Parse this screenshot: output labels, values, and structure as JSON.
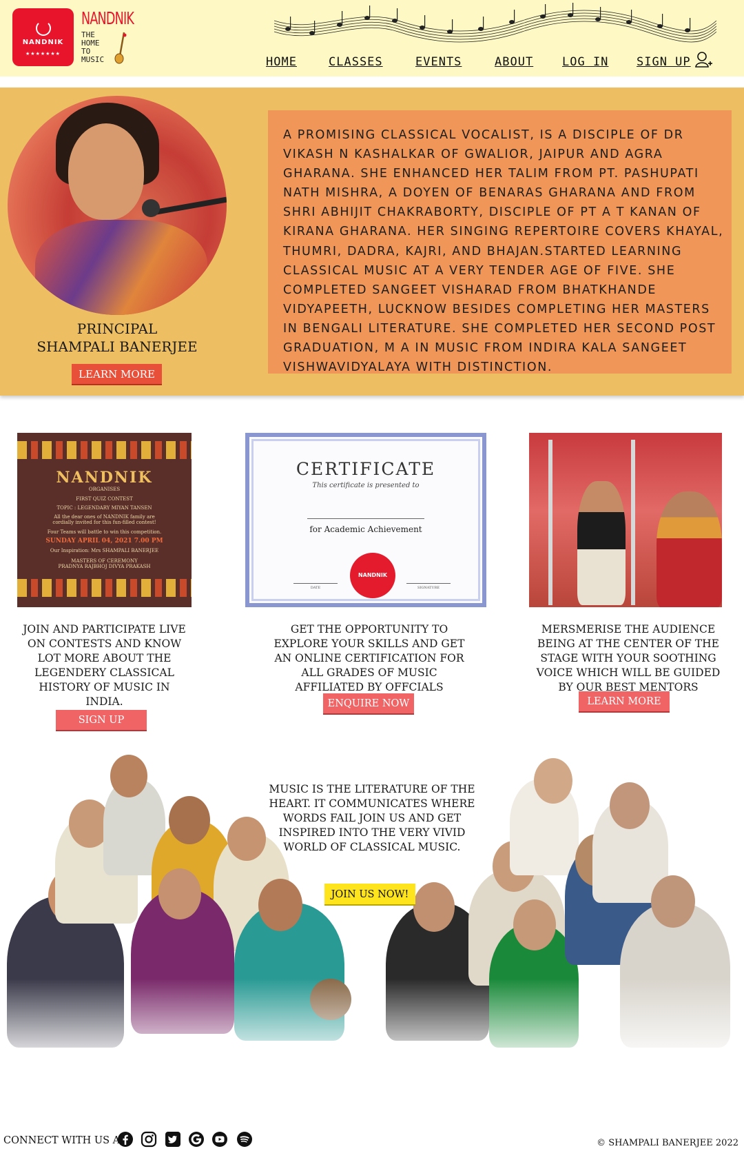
{
  "brand": {
    "logo_text": "NANDNIK",
    "name": "NANDNIK",
    "tagline": [
      "THE",
      "HOME",
      "TO",
      "MUSIC"
    ]
  },
  "nav": {
    "items": [
      "HOME",
      "CLASSES",
      "EVENTS",
      "ABOUT",
      "LOG IN",
      "SIGN UP"
    ]
  },
  "principal": {
    "role": "PRINCIPAL",
    "name": "SHAMPALI BANERJEE",
    "button": "LEARN MORE",
    "bio": "A PROMISING CLASSICAL VOCALIST, IS A DISCIPLE OF DR VIKASH N KASHALKAR OF GWALIOR,  JAIPUR AND AGRA GHARANA. SHE ENHANCED HER TALIM FROM PT. PASHUPATI NATH MISHRA, A DOYEN OF  BENARAS GHARANA AND FROM SHRI ABHIJIT CHAKRABORTY, DISCIPLE OF PT A T KANAN OF KIRANA GHARANA. HER  SINGING REPERTOIRE COVERS KHAYAL, THUMRI, DADRA, KAJRI, AND BHAJAN.STARTED LEARNING CLASSICAL MUSIC AT A VERY TENDER AGE OF FIVE. SHE COMPLETED  SANGEET VISHARAD FROM BHATKHANDE VIDYAPEETH, LUCKNOW BESIDES COMPLETING HER MASTERS IN BENGALI  LITERATURE. SHE COMPLETED HER SECOND POST GRADUATION, M A IN MUSIC FROM INDIRA KALA SANGEET VISHWAVIDYALAYA WITH DISTINCTION."
  },
  "poster": {
    "title": "NANDNIK",
    "organises": "ORGANISES",
    "contest": "FIRST QUIZ CONTEST",
    "topic": "TOPIC : LEGENDARY MIYAN TANSEN",
    "invite": "All the dear ones of NANDNIK family are cordially invited for this fun-filled contest!",
    "teams": "Four Teams will battle to win this competition.",
    "date": "SUNDAY    APRIL 04, 2021    7.00 PM",
    "inspiration": "Our Inspiration: Mrs SHAMPALI BANERJEE",
    "masters": "MASTERS OF CEREMONY",
    "hosts": "PRADNYA RAJBHOJ          DIVYA PRAKASH"
  },
  "certificate": {
    "title": "CERTIFICATE",
    "subtitle": "This certificate is presented to",
    "for": "for Academic Achievement",
    "seal": "NANDNIK",
    "date_label": "DATE",
    "signature_label": "SIGNATURE"
  },
  "cards": [
    {
      "text": "JOIN AND PARTICIPATE LIVE ON CONTESTS AND KNOW LOT MORE ABOUT THE LEGENDERY CLASSICAL HISTORY OF MUSIC IN INDIA.",
      "button": "SIGN UP"
    },
    {
      "text": "GET THE OPPORTUNITY TO EXPLORE YOUR SKILLS AND GET AN ONLINE CERTIFICATION FOR ALL GRADES OF MUSIC AFFILIATED BY OFFCIALS",
      "button": "ENQUIRE NOW"
    },
    {
      "text": "MERSMERISE THE AUDIENCE BEING AT THE CENTER OF THE STAGE WITH YOUR SOOTHING VOICE WHICH WILL BE GUIDED BY OUR BEST MENTORS",
      "button": "LEARN MORE"
    }
  ],
  "quote": {
    "text": "MUSIC IS THE LITERATURE OF THE HEART. IT COMMUNICATES WHERE WORDS FAIL JOIN US AND GET INSPIRED INTO THE VERY VIVID WORLD OF CLASSICAL MUSIC.",
    "button": "JOIN US NOW!"
  },
  "footer": {
    "connect": "CONNECT WITH US AT",
    "social_icons": [
      "facebook-icon",
      "instagram-icon",
      "twitter-icon",
      "google-icon",
      "youtube-icon",
      "spotify-icon"
    ],
    "copyright": "© SHAMPALI BANERJEE 2022"
  },
  "colors": {
    "header_bg": "#fdf8c4",
    "brand_red": "#e8142c",
    "principal_bg": "#edbe62",
    "bio_bg": "#ef9658",
    "button_red": "#e8503a",
    "button_pink": "#f16466",
    "button_yellow": "#fde41c"
  }
}
